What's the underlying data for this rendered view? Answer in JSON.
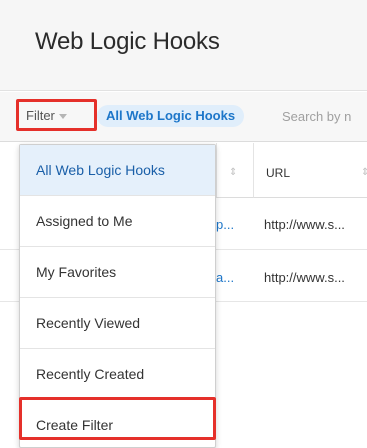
{
  "header": {
    "title": "Web Logic Hooks"
  },
  "toolbar": {
    "filter_label": "Filter",
    "active_filter_pill": "All Web Logic Hooks",
    "search_placeholder": "Search by n"
  },
  "table": {
    "columns": [
      {
        "label": "URL"
      }
    ],
    "rows": [
      {
        "name_fragment": "p...",
        "url": "http://www.s..."
      },
      {
        "name_fragment": "a...",
        "url": "http://www.s..."
      }
    ]
  },
  "filter_menu": {
    "items": [
      {
        "label": "All Web Logic Hooks",
        "selected": true
      },
      {
        "label": "Assigned to Me"
      },
      {
        "label": "My Favorites"
      },
      {
        "label": "Recently Viewed"
      },
      {
        "label": "Recently Created"
      },
      {
        "label": "Create Filter"
      }
    ]
  },
  "colors": {
    "highlight": "#e5302a",
    "link": "#1d76c9",
    "selected_bg": "#e5f0fb"
  }
}
